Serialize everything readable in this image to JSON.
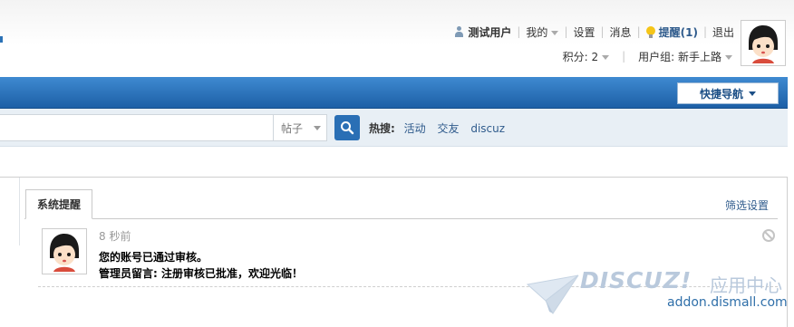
{
  "header": {
    "username": "测试用户",
    "my_label": "我的",
    "settings_label": "设置",
    "messages_label": "消息",
    "reminder_label": "提醒(1)",
    "logout_label": "退出",
    "points_label": "积分: 2",
    "usergroup_label": "用户组: 新手上路"
  },
  "nav": {
    "quick_nav_label": "快捷导航"
  },
  "search": {
    "placeholder": "",
    "type_label": "帖子",
    "hot_label": "热搜:",
    "hot_terms": [
      "活动",
      "交友",
      "discuz"
    ]
  },
  "notices": {
    "tab_label": "系统提醒",
    "filter_label": "筛选设置",
    "item": {
      "time": "8 秒前",
      "line1": "您的账号已通过审核。",
      "line2": "管理员留言: 注册审核已批准，欢迎光临！"
    }
  },
  "watermark": {
    "brand": "DISCUZ!",
    "cn": "应用中心",
    "url": "addon.dismall.com"
  },
  "colors": {
    "nav_blue": "#1d5fa6",
    "link_blue": "#2f5b8c"
  }
}
